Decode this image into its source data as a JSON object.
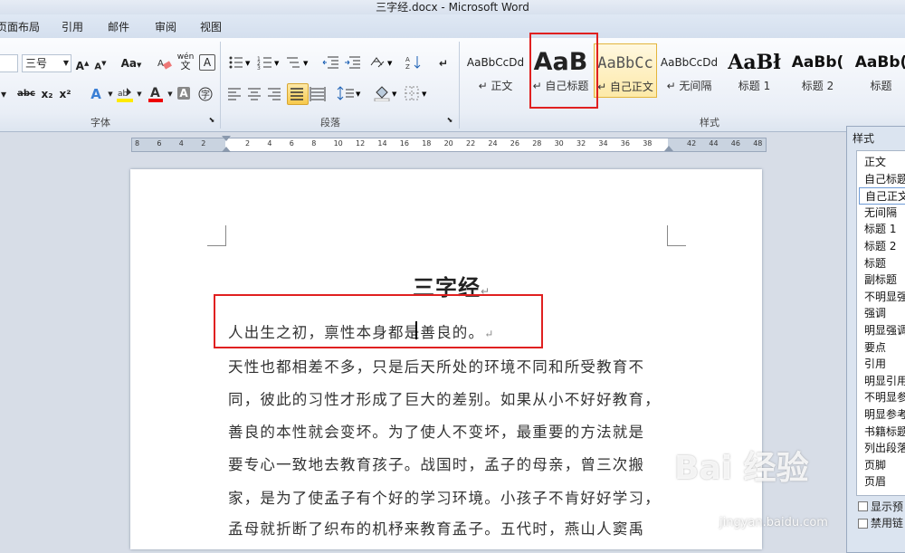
{
  "window": {
    "title": "三字经.docx - Microsoft Word"
  },
  "tabs": [
    "页面布局",
    "引用",
    "邮件",
    "审阅",
    "视图"
  ],
  "font_group": {
    "label": "字体",
    "font_size": "三号",
    "buttons": {
      "grow": "A",
      "shrink": "A",
      "change_case": "Aa",
      "phonetic": "wén",
      "strike": "abc",
      "sub": "x₂",
      "sup": "x²"
    }
  },
  "paragraph_group": {
    "label": "段落"
  },
  "styles_group": {
    "label": "样式",
    "items": [
      {
        "preview": "AaBbCcDd",
        "name": "↵ 正文"
      },
      {
        "preview": "AaB",
        "name": "↵ 自己标题"
      },
      {
        "preview": "AaBbCc",
        "name": "↵ 自己正文"
      },
      {
        "preview": "AaBbCcDd",
        "name": "↵ 无间隔"
      },
      {
        "preview": "AaBł",
        "name": "标题 1"
      },
      {
        "preview": "AaBb(",
        "name": "标题 2"
      },
      {
        "preview": "AaBb(",
        "name": "标题"
      }
    ]
  },
  "ruler": {
    "ticks": [
      "8",
      "6",
      "4",
      "2",
      "",
      "2",
      "4",
      "6",
      "8",
      "10",
      "12",
      "14",
      "16",
      "18",
      "20",
      "22",
      "24",
      "26",
      "28",
      "30",
      "32",
      "34",
      "36",
      "38",
      "",
      "42",
      "44",
      "46",
      "48"
    ]
  },
  "document": {
    "title": "三字经",
    "lines": [
      "人出生之初，禀性本身都是善良的。",
      "天性也都相差不多，只是后天所处的环境不同和所受教育不",
      "同，彼此的习性才形成了巨大的差别。如果从小不好好教育，",
      "善良的本性就会变坏。为了使人不变坏，最重要的方法就是",
      "要专心一致地去教育孩子。战国时，孟子的母亲，曾三次搬",
      "家，是为了使孟子有个好的学习环境。小孩子不肯好好学习，",
      "孟母就折断了织布的机杼来教育孟子。五代时，燕山人窦禹"
    ],
    "pilcrow": "↵"
  },
  "styles_pane": {
    "title": "样式",
    "items": [
      "正文",
      "自己标题",
      "自己正文",
      "无间隔",
      "标题 1",
      "标题 2",
      "标题",
      "副标题",
      "不明显强",
      "强调",
      "明显强调",
      "要点",
      "引用",
      "明显引用",
      "不明显参",
      "明显参考",
      "书籍标题",
      "列出段落",
      "页脚",
      "页眉"
    ],
    "selected_index": 2,
    "options": [
      "显示预",
      "禁用链"
    ]
  },
  "watermark": {
    "brand": "Bai 经验",
    "url": "jingyan.baidu.com"
  },
  "colors": {
    "highlight_box": "#e02020",
    "accent": "#f2c94c"
  }
}
